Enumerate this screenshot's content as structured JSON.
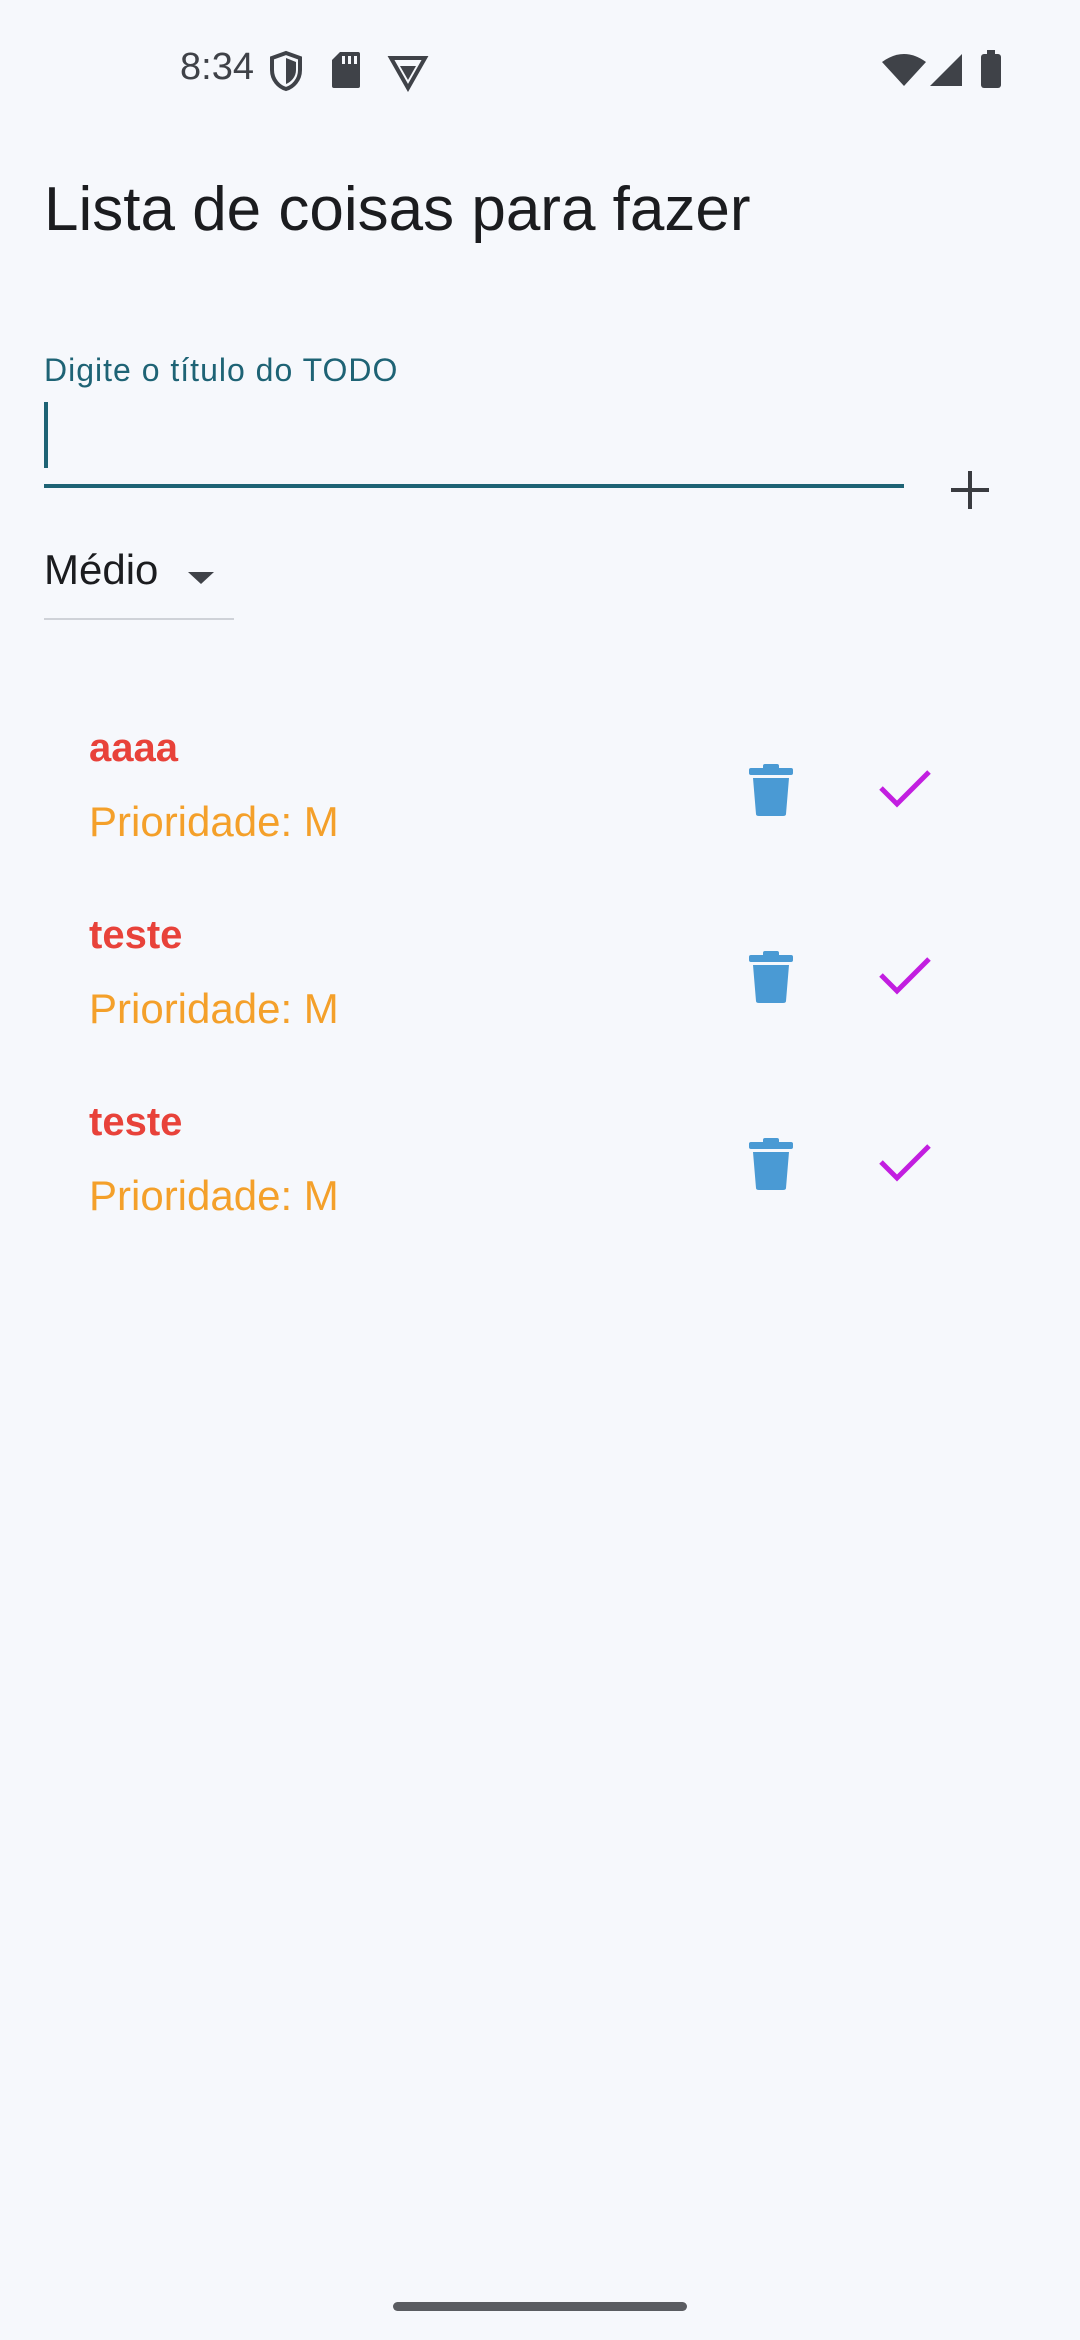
{
  "status_bar": {
    "time": "8:34",
    "icons": [
      "shield-icon",
      "sd-card-icon",
      "vpn-badge-icon",
      "wifi-icon",
      "signal-icon",
      "battery-icon"
    ]
  },
  "app": {
    "title": "Lista de coisas para fazer"
  },
  "input": {
    "label": "Digite o título do TODO",
    "value": ""
  },
  "add_button": {
    "icon": "plus-icon"
  },
  "priority_select": {
    "selected": "Médio"
  },
  "todos": [
    {
      "title": "aaaa",
      "priority": "Prioridade: M"
    },
    {
      "title": "teste",
      "priority": "Prioridade: M"
    },
    {
      "title": "teste",
      "priority": "Prioridade: M"
    }
  ],
  "colors": {
    "background": "#f6f8fc",
    "accent": "#1e6375",
    "todo_title": "#e8423a",
    "todo_priority": "#f4a02a",
    "trash": "#4a9ad4",
    "check": "#c21ee0"
  }
}
